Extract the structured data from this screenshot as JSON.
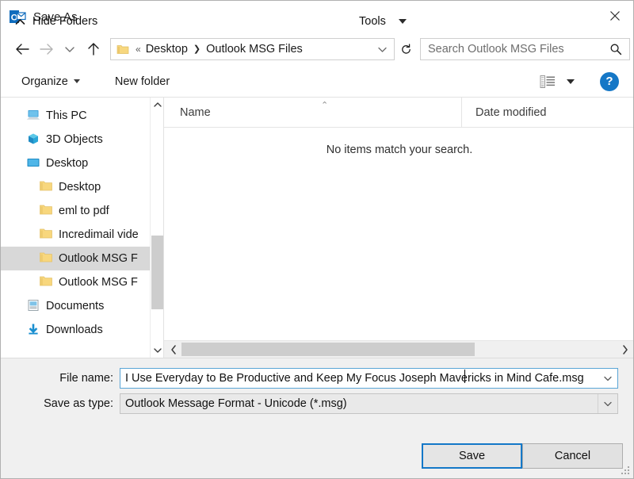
{
  "window": {
    "title": "Save As",
    "app_icon": "outlook-icon",
    "close_label": "✕"
  },
  "nav": {
    "back_icon": "arrow-left-icon",
    "forward_icon": "arrow-right-icon",
    "recent_icon": "chevron-down-icon",
    "up_icon": "arrow-up-icon",
    "refresh_icon": "refresh-icon",
    "breadcrumb_overflow": "«",
    "breadcrumb": [
      "Desktop",
      "Outlook MSG Files"
    ],
    "breadcrumb_separator": "❯",
    "address_dropdown_icon": "chevron-down-icon"
  },
  "search": {
    "placeholder": "Search Outlook MSG Files",
    "icon": "search-icon"
  },
  "toolbar": {
    "organize_label": "Organize",
    "new_folder_label": "New folder",
    "view_icon": "list-view-icon",
    "view_dropdown_icon": "chevron-down-icon",
    "help_label": "?"
  },
  "sidebar": {
    "items": [
      {
        "label": "This PC",
        "icon": "this-pc-icon",
        "level": 0,
        "selected": false
      },
      {
        "label": "3D Objects",
        "icon": "3d-objects-icon",
        "level": 0,
        "selected": false
      },
      {
        "label": "Desktop",
        "icon": "desktop-icon",
        "level": 0,
        "selected": false
      },
      {
        "label": "Desktop",
        "icon": "folder-icon",
        "level": 1,
        "selected": false
      },
      {
        "label": "eml to pdf",
        "icon": "folder-icon",
        "level": 1,
        "selected": false
      },
      {
        "label": "Incredimail vide",
        "icon": "folder-icon",
        "level": 1,
        "selected": false
      },
      {
        "label": "Outlook MSG F",
        "icon": "folder-icon",
        "level": 1,
        "selected": true
      },
      {
        "label": "Outlook MSG F",
        "icon": "folder-icon",
        "level": 1,
        "selected": false
      },
      {
        "label": "Documents",
        "icon": "documents-icon",
        "level": 0,
        "selected": false
      },
      {
        "label": "Downloads",
        "icon": "downloads-icon",
        "level": 0,
        "selected": false
      }
    ],
    "scrollbar": {
      "up_icon": "chevron-up-icon",
      "down_icon": "chevron-down-icon"
    }
  },
  "filelist": {
    "columns": [
      "Name",
      "Date modified"
    ],
    "sort_indicator": "⌃",
    "empty_message": "No items match your search.",
    "rows": [],
    "hscroll": {
      "left_icon": "chevron-left-icon",
      "right_icon": "chevron-right-icon"
    }
  },
  "form": {
    "file_name_label": "File name:",
    "file_name_value": "I Use Everyday to Be Productive and Keep My Focus  Joseph Mavericks in Mind Cafe.msg",
    "file_name_dropdown_icon": "chevron-down-icon",
    "save_type_label": "Save as type:",
    "save_type_value": "Outlook Message Format - Unicode (*.msg)",
    "save_type_dropdown_icon": "chevron-down-icon"
  },
  "footer": {
    "hide_folders_label": "Hide Folders",
    "hide_folders_icon": "chevron-up-icon",
    "tools_label": "Tools",
    "tools_dropdown_icon": "chevron-down-icon",
    "save_label": "Save",
    "cancel_label": "Cancel"
  },
  "colors": {
    "accent": "#1478c8",
    "selection": "#d8d8d8",
    "chrome": "#f0f0f0",
    "folder": "#fbd978"
  }
}
